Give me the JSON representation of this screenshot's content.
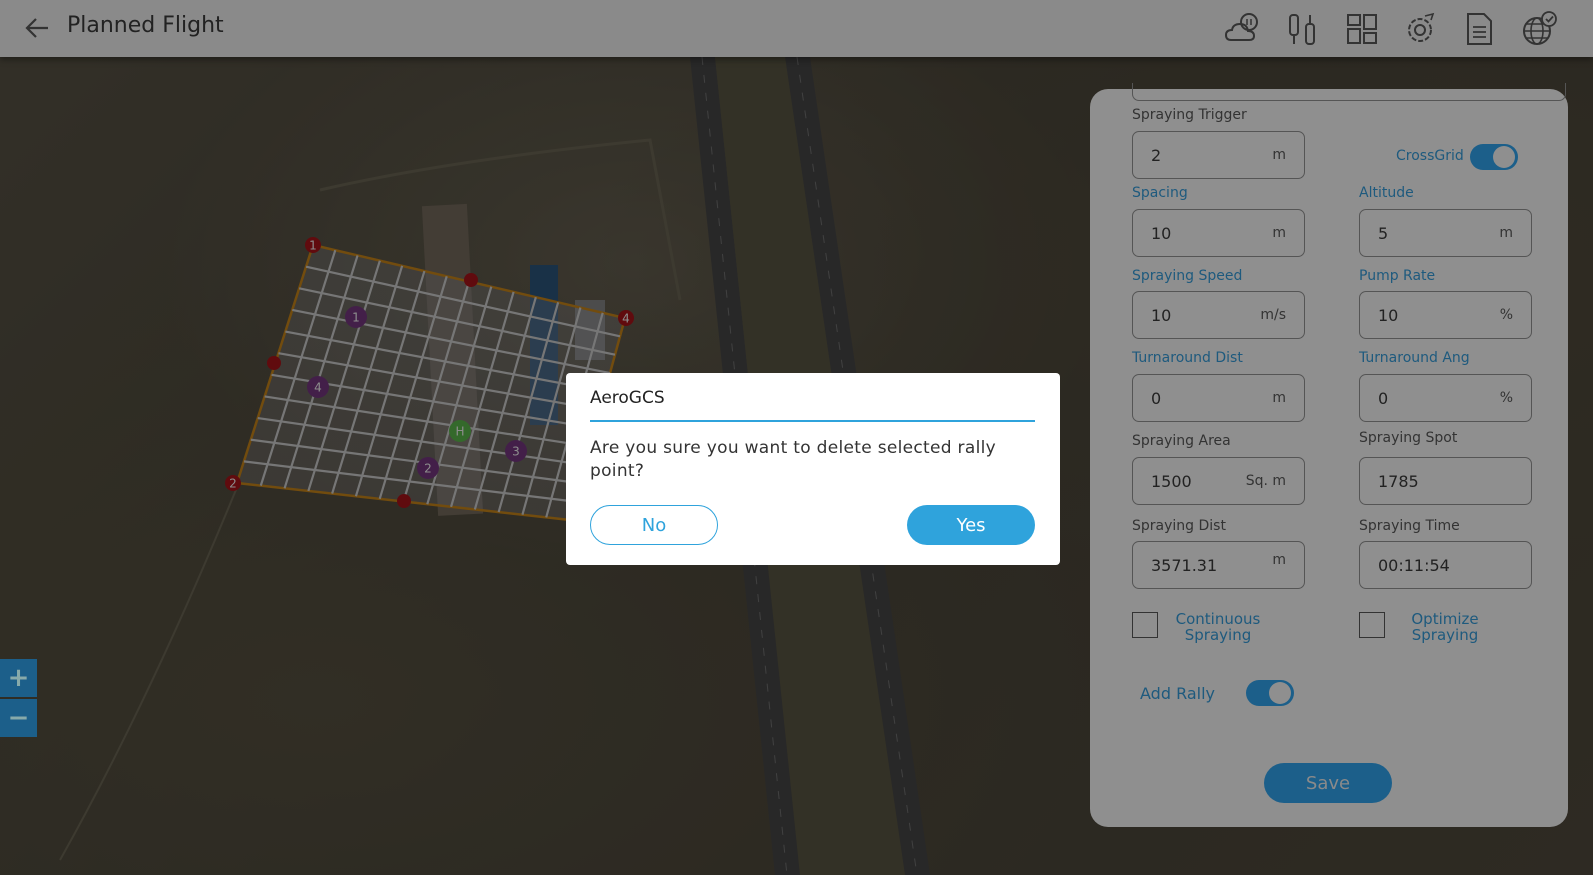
{
  "header": {
    "title": "Planned Flight",
    "icons": [
      "back-arrow-icon",
      "weather-icon",
      "controller-icon",
      "layout-icon",
      "settings-icon",
      "document-icon",
      "globe-check-icon"
    ]
  },
  "map": {
    "waypoints": [
      "1",
      "2",
      "4"
    ],
    "rally_points": [
      "1",
      "2",
      "3",
      "4"
    ],
    "home_label": "H",
    "zoom_in": "+",
    "zoom_out": "−"
  },
  "panel": {
    "spraying_trigger": {
      "label": "Spraying Trigger",
      "value": "2",
      "unit": "m"
    },
    "crossgrid": {
      "label": "CrossGrid",
      "on": true
    },
    "spacing": {
      "label": "Spacing",
      "value": "10",
      "unit": "m"
    },
    "altitude": {
      "label": "Altitude",
      "value": "5",
      "unit": "m"
    },
    "spraying_speed": {
      "label": "Spraying Speed",
      "value": "10",
      "unit": "m/s"
    },
    "pump_rate": {
      "label": "Pump Rate",
      "value": "10",
      "unit": "%"
    },
    "turnaround_dist": {
      "label": "Turnaround Dist",
      "value": "0",
      "unit": "m"
    },
    "turnaround_ang": {
      "label": "Turnaround Ang",
      "value": "0",
      "unit": "%"
    },
    "spraying_area": {
      "label": "Spraying Area",
      "value": "1500",
      "unit": "Sq. m"
    },
    "spraying_spot": {
      "label": "Spraying Spot",
      "value": "1785"
    },
    "spraying_dist": {
      "label": "Spraying Dist",
      "value": "3571.31",
      "unit": "m"
    },
    "spraying_time": {
      "label": "Spraying Time",
      "value": "00:11:54"
    },
    "continuous_spraying": {
      "line1": "Continuous",
      "line2": "Spraying",
      "checked": false
    },
    "optimize_spraying": {
      "line1": "Optimize",
      "line2": "Spraying",
      "checked": false
    },
    "add_rally": {
      "label": "Add Rally",
      "on": true
    },
    "save_label": "Save"
  },
  "dialog": {
    "title": "AeroGCS",
    "message": "Are you sure you want to delete selected rally point?",
    "no_label": "No",
    "yes_label": "Yes"
  },
  "colors": {
    "accent": "#2fa3dc",
    "waypoint": "#b0141b",
    "rally": "#7a3a86",
    "home": "#5fbf4f",
    "boundary": "#d08a1a"
  }
}
